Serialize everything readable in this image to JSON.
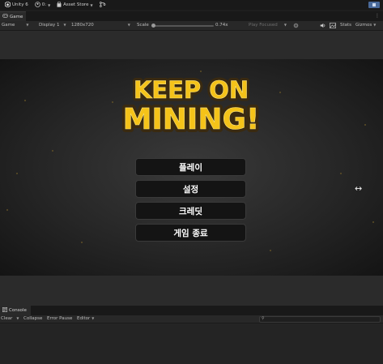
{
  "topbar": {
    "unity_label": "Unity 6",
    "account_label": "0:",
    "asset_store_label": "Asset Store"
  },
  "game_tab": {
    "label": "Game"
  },
  "game_toolbar": {
    "view_mode": "Game",
    "display": "Display 1",
    "resolution": "1280x720",
    "scale_label": "Scale",
    "scale_value": "0.74x",
    "play_focused": "Play Focused",
    "stats_label": "Stats",
    "gizmos_label": "Gizmos"
  },
  "game": {
    "logo_line1": "KEEP ON",
    "logo_line2": "MINING!",
    "menu": {
      "play": "플레이",
      "settings": "설정",
      "credits": "크레딧",
      "quit": "게임 종료"
    }
  },
  "console": {
    "tab_label": "Console",
    "clear_label": "Clear",
    "collapse_label": "Collapse",
    "error_pause_label": "Error Pause",
    "editor_label": "Editor"
  },
  "colors": {
    "logo_fill": "#f5c319",
    "logo_outline": "#3a2a10",
    "button_bg": "#141414"
  }
}
